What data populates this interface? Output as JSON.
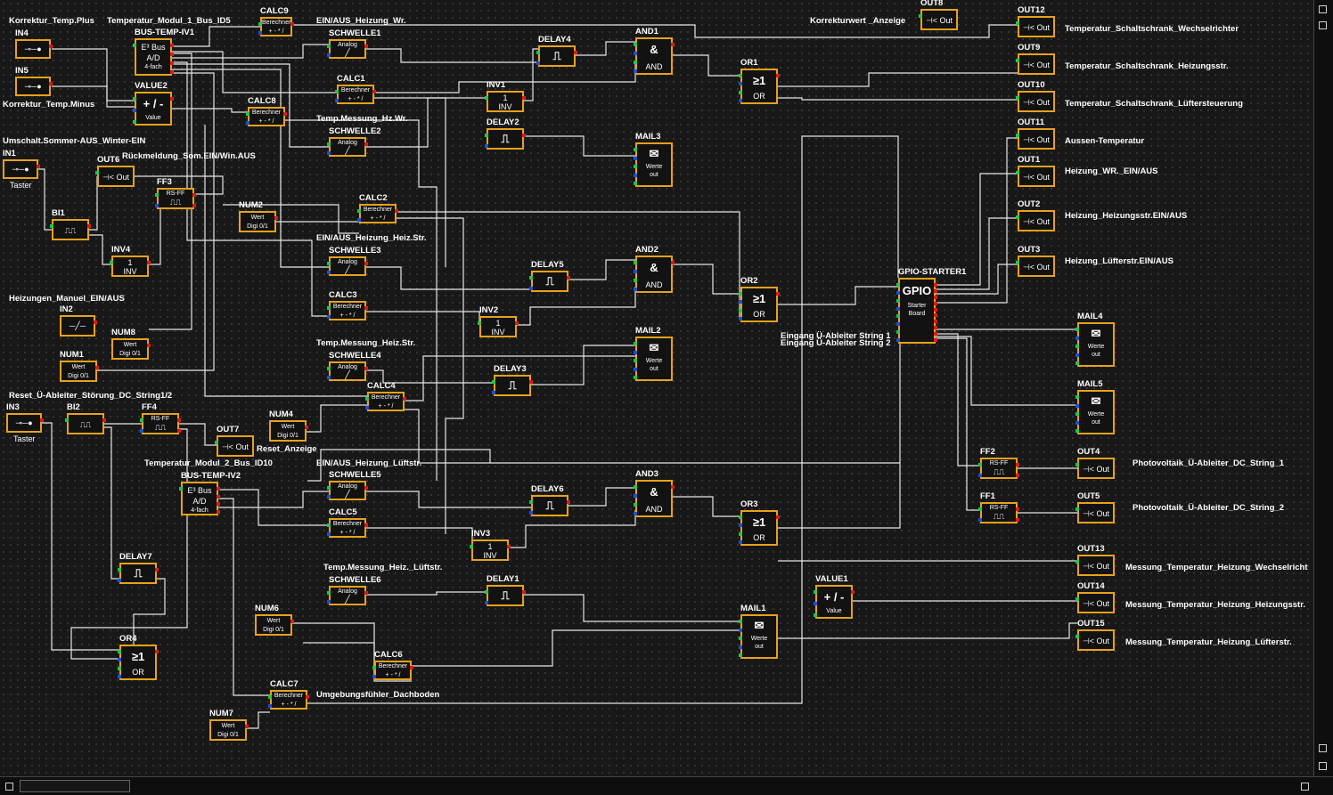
{
  "titles": [
    "Korrektur_Temp.Plus",
    "Temperatur_Modul_1_Bus_ID5",
    "Korrektur_Temp.Minus",
    "Umschalt.Sommer-AUS_Winter-EIN",
    "Rückmeldung_Som.EIN/Win.AUS",
    "EIN/AUS_Heizung_Wr.",
    "Temp.Messung_Hz.Wr.",
    "EIN/AUS_Heizung_Heiz.Str.",
    "Temp.Messung_Heiz.Str.",
    "Heizungen_Manuel_EIN/AUS",
    "Reset_Ü-Ableiter_Störung_DC_String1/2",
    "Reset_Anzeige",
    "Temperatur_Modul_2_Bus_ID10",
    "EIN/AUS_Heizung_Lüftstr.",
    "Temp.Messung_Heiz._Lüftstr.",
    "Umgebungsfühler_Dachboden",
    "Korrekturwert _Anzeige",
    "Temperatur_Schaltschrank_Wechselrichter",
    "Temperatur_Schaltschrank_Heizungsstr.",
    "Temperatur_Schaltschrank_Lüftersteuerung",
    "Aussen-Temperatur",
    "Heizung_WR._EIN/AUS",
    "Heizung_Heizungsstr.EIN/AUS",
    "Heizung_Lüfterstr.EIN/AUS",
    "Eingang Ü-Ableiter String 1",
    "Eingang Ü-Ableiter String 2",
    "Photovoltaik_Ü-Ableiter_DC_String_1",
    "Photovoltaik_Ü-Ableiter_DC_String_2",
    "Messung_Temperatur_Heizung_Wechselricht",
    "Messung_Temperatur_Heizung_Heizungsstr.",
    "Messung_Temperatur_Heizung_Lüfterstr."
  ],
  "block_texts": {
    "taster": "Taster",
    "out": "Out",
    "bus": "Bus",
    "ad": "A/D",
    "vierfach": "4-fach",
    "value_sym": "+ / -",
    "value": "Value",
    "berechner": "Berechner",
    "ops": "+ - * /",
    "analog": "Analog",
    "wert": "Wert",
    "digi": "Digi 0/1",
    "inv_one": "1",
    "inv": "INV",
    "and_sym": "&",
    "and": "AND",
    "or_sym": "≥1",
    "or": "OR",
    "rsff": "RS-FF",
    "werte": "Werte",
    "out_small": "out",
    "gpio": "GPIO",
    "starter": "Starter",
    "board": "Board"
  },
  "blocks": [
    {
      "id": "IN4",
      "type": "button"
    },
    {
      "id": "IN5",
      "type": "button"
    },
    {
      "id": "IN1",
      "type": "taster"
    },
    {
      "id": "IN2",
      "type": "switch"
    },
    {
      "id": "IN3",
      "type": "taster"
    },
    {
      "id": "BUS-TEMP-IV1",
      "type": "bus"
    },
    {
      "id": "BUS-TEMP-IV2",
      "type": "bus"
    },
    {
      "id": "VALUE2",
      "type": "value"
    },
    {
      "id": "VALUE1",
      "type": "value"
    },
    {
      "id": "CALC9",
      "type": "calc"
    },
    {
      "id": "CALC8",
      "type": "calc"
    },
    {
      "id": "CALC1",
      "type": "calc"
    },
    {
      "id": "CALC2",
      "type": "calc"
    },
    {
      "id": "CALC3",
      "type": "calc"
    },
    {
      "id": "CALC4",
      "type": "calc"
    },
    {
      "id": "CALC5",
      "type": "calc"
    },
    {
      "id": "CALC6",
      "type": "calc"
    },
    {
      "id": "CALC7",
      "type": "calc"
    },
    {
      "id": "SCHWELLE1",
      "type": "schwelle"
    },
    {
      "id": "SCHWELLE2",
      "type": "schwelle"
    },
    {
      "id": "SCHWELLE3",
      "type": "schwelle"
    },
    {
      "id": "SCHWELLE4",
      "type": "schwelle"
    },
    {
      "id": "SCHWELLE5",
      "type": "schwelle"
    },
    {
      "id": "SCHWELLE6",
      "type": "schwelle"
    },
    {
      "id": "NUM2",
      "type": "num"
    },
    {
      "id": "NUM8",
      "type": "num"
    },
    {
      "id": "NUM1",
      "type": "num"
    },
    {
      "id": "NUM4",
      "type": "num"
    },
    {
      "id": "NUM6",
      "type": "num"
    },
    {
      "id": "NUM7",
      "type": "num"
    },
    {
      "id": "BI1",
      "type": "bi"
    },
    {
      "id": "BI2",
      "type": "bi"
    },
    {
      "id": "INV1",
      "type": "inv"
    },
    {
      "id": "INV2",
      "type": "inv"
    },
    {
      "id": "INV3",
      "type": "inv"
    },
    {
      "id": "INV4",
      "type": "inv"
    },
    {
      "id": "DELAY4",
      "type": "delay"
    },
    {
      "id": "DELAY2",
      "type": "delay"
    },
    {
      "id": "DELAY5",
      "type": "delay"
    },
    {
      "id": "DELAY3",
      "type": "delay"
    },
    {
      "id": "DELAY6",
      "type": "delay"
    },
    {
      "id": "DELAY1",
      "type": "delay"
    },
    {
      "id": "DELAY7",
      "type": "delay"
    },
    {
      "id": "AND1",
      "type": "and"
    },
    {
      "id": "AND2",
      "type": "and"
    },
    {
      "id": "AND3",
      "type": "and"
    },
    {
      "id": "OR1",
      "type": "or"
    },
    {
      "id": "OR2",
      "type": "or"
    },
    {
      "id": "OR3",
      "type": "or"
    },
    {
      "id": "OR4",
      "type": "or"
    },
    {
      "id": "FF3",
      "type": "ff"
    },
    {
      "id": "FF4",
      "type": "ff"
    },
    {
      "id": "FF2",
      "type": "ff"
    },
    {
      "id": "FF1",
      "type": "ff"
    },
    {
      "id": "MAIL3",
      "type": "mail"
    },
    {
      "id": "MAIL2",
      "type": "mail"
    },
    {
      "id": "MAIL1",
      "type": "mail"
    },
    {
      "id": "MAIL4",
      "type": "mail"
    },
    {
      "id": "MAIL5",
      "type": "mail"
    },
    {
      "id": "GPIO-STARTER1",
      "type": "gpio"
    },
    {
      "id": "OUT8",
      "type": "out"
    },
    {
      "id": "OUT6",
      "type": "out"
    },
    {
      "id": "OUT7",
      "type": "out"
    },
    {
      "id": "OUT12",
      "type": "out"
    },
    {
      "id": "OUT9",
      "type": "out"
    },
    {
      "id": "OUT10",
      "type": "out"
    },
    {
      "id": "OUT11",
      "type": "out"
    },
    {
      "id": "OUT1",
      "type": "out"
    },
    {
      "id": "OUT2",
      "type": "out"
    },
    {
      "id": "OUT3",
      "type": "out"
    },
    {
      "id": "OUT4",
      "type": "out"
    },
    {
      "id": "OUT5",
      "type": "out"
    },
    {
      "id": "OUT13",
      "type": "out"
    },
    {
      "id": "OUT14",
      "type": "out"
    },
    {
      "id": "OUT15",
      "type": "out"
    }
  ],
  "colors": {
    "block_border": "#e8a21a",
    "background": "#181818",
    "wire": "#e6e6e6",
    "port_in_a": "#19c94a",
    "port_in_b": "#1b4fd8",
    "port_out": "#e01818"
  }
}
